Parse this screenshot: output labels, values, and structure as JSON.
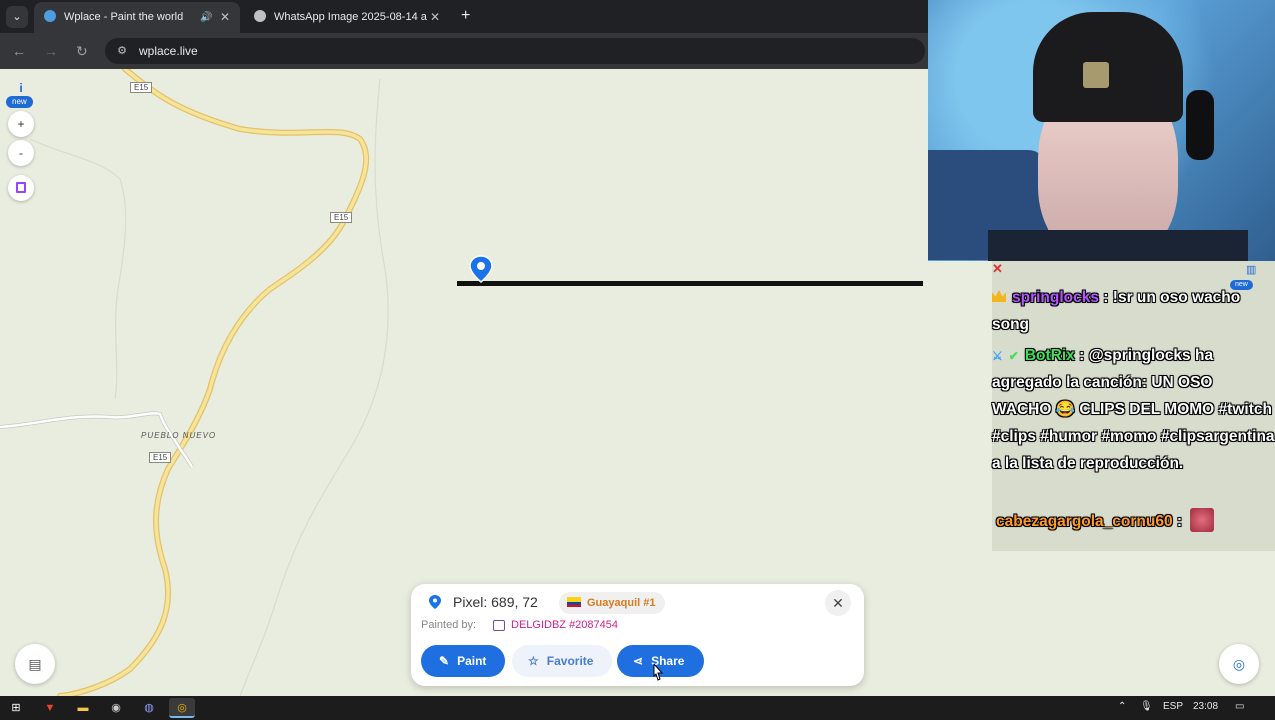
{
  "browser": {
    "tabs": [
      {
        "title": "Wplace - Paint the world",
        "active": true,
        "audio": true
      },
      {
        "title": "WhatsApp Image 2025-08-14 a",
        "active": false,
        "audio": false
      }
    ],
    "new_tab_glyph": "+",
    "url": "wplace.live",
    "nav": {
      "back": "←",
      "forward": "→",
      "reload": "↻"
    }
  },
  "map": {
    "road_labels": [
      "E15",
      "E15",
      "E15"
    ],
    "place_label": "PUEBLO NUEVO",
    "controls": {
      "info_glyph": "i",
      "new_badge": "new",
      "zoom_in": "+",
      "zoom_out": "-"
    }
  },
  "pixel_panel": {
    "coordinates": "Pixel: 689, 72",
    "region": "Guayaquil #1",
    "painted_by_label": "Painted by:",
    "painter": "DELGIDBZ #2087454",
    "close_glyph": "✕",
    "buttons": {
      "paint": "Paint",
      "favorite": "Favorite",
      "share": "Share"
    }
  },
  "chat": {
    "corner_badge": "new",
    "messages": [
      {
        "user": "springlocks",
        "user_color": "#b455ff",
        "text": "!sr un oso wacho song"
      },
      {
        "user": "BotRix",
        "user_color": "#3ee05a",
        "text": "@springlocks ha agregado la canción: UN OSO WACHO 😂 CLIPS DEL MOMO #twitch #clips #humor #momo #clipsargentina a la lista de reproducción."
      },
      {
        "user": "cabezagargola_cornu60",
        "user_color": "#ff9a2e",
        "text": ""
      }
    ]
  },
  "taskbar": {
    "language": "ESP",
    "time": "23:08"
  },
  "colors": {
    "accent": "#1f6fe0",
    "map_background": "#e9eddf",
    "road": "#f2d27a",
    "region_text": "#d97a1d",
    "painter_text": "#d0218a"
  }
}
